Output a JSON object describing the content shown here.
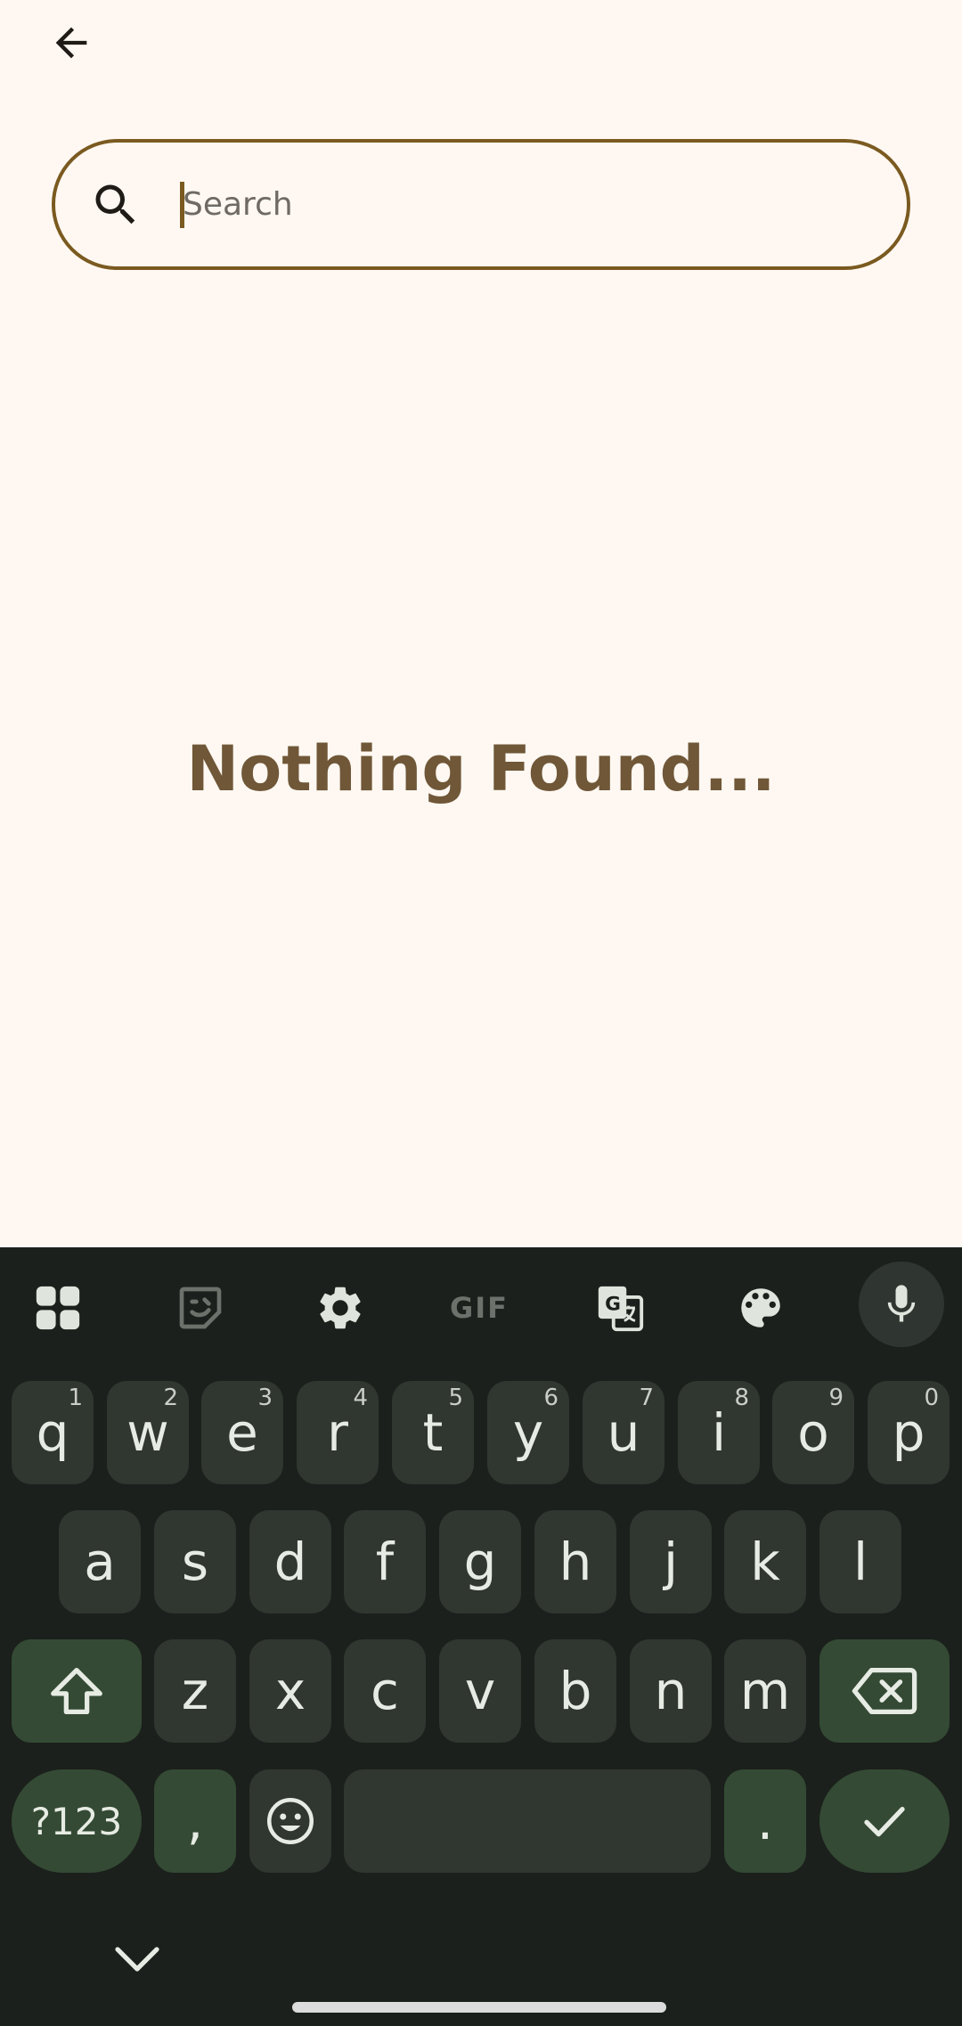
{
  "search": {
    "placeholder": "Search",
    "value": ""
  },
  "empty_state": {
    "message": "Nothing Found..."
  },
  "keyboard": {
    "toolbar": {
      "gif_label": "GIF"
    },
    "row1": [
      {
        "label": "q",
        "hint": "1"
      },
      {
        "label": "w",
        "hint": "2"
      },
      {
        "label": "e",
        "hint": "3"
      },
      {
        "label": "r",
        "hint": "4"
      },
      {
        "label": "t",
        "hint": "5"
      },
      {
        "label": "y",
        "hint": "6"
      },
      {
        "label": "u",
        "hint": "7"
      },
      {
        "label": "i",
        "hint": "8"
      },
      {
        "label": "o",
        "hint": "9"
      },
      {
        "label": "p",
        "hint": "0"
      }
    ],
    "row2": [
      "a",
      "s",
      "d",
      "f",
      "g",
      "h",
      "j",
      "k",
      "l"
    ],
    "row3": [
      "z",
      "x",
      "c",
      "v",
      "b",
      "n",
      "m"
    ],
    "row4": {
      "symbols_label": "?123",
      "comma_label": ",",
      "period_label": "."
    }
  },
  "colors": {
    "background": "#fff8f2",
    "accent": "#7a5a20",
    "empty_text": "#6f5738",
    "keyboard_bg": "#1b201c",
    "key_bg": "#303630",
    "key_accent": "#344a34"
  }
}
